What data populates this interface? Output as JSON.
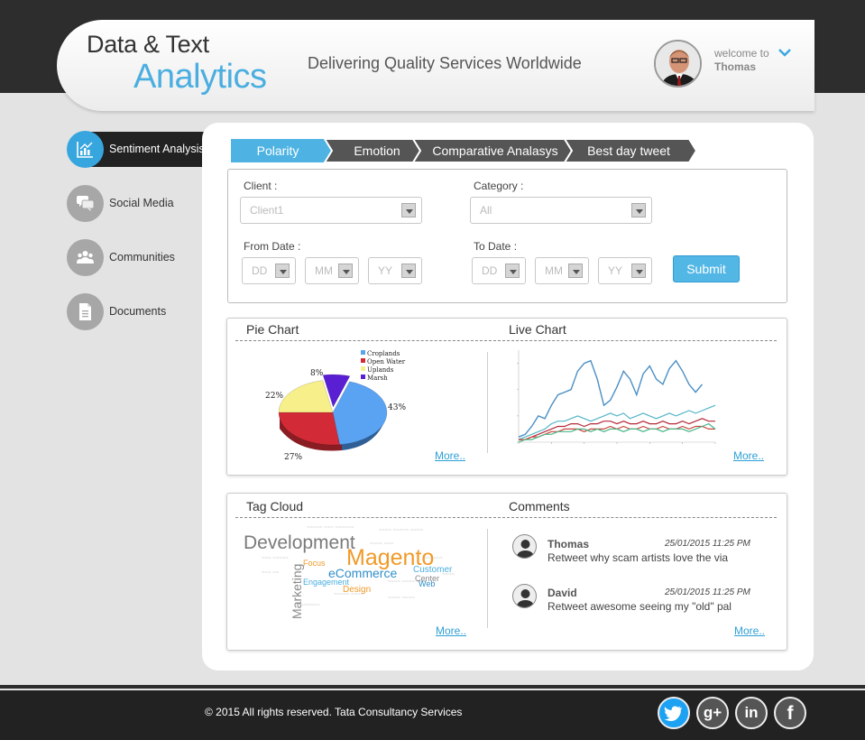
{
  "header": {
    "logo_line1": "Data & Text",
    "logo_line2": "Analytics",
    "tagline": "Delivering Quality Services Worldwide",
    "welcome": "welcome to",
    "user": "Thomas"
  },
  "sidebar": {
    "items": [
      {
        "label": "Sentiment Analysis",
        "icon": "chart-icon",
        "active": true
      },
      {
        "label": "Social Media",
        "icon": "chat-icon",
        "active": false
      },
      {
        "label": "Communities",
        "icon": "people-icon",
        "active": false
      },
      {
        "label": "Documents",
        "icon": "document-icon",
        "active": false
      }
    ]
  },
  "tabs": [
    "Polarity",
    "Emotion",
    "Comparative Analasys",
    "Best day tweet"
  ],
  "form": {
    "client_label": "Client :",
    "client_value": "Client1",
    "category_label": "Category :",
    "category_value": "All",
    "from_label": "From Date :",
    "to_label": "To Date :",
    "dd": "DD",
    "mm": "MM",
    "yy": "YY",
    "submit": "Submit"
  },
  "pie_panel": {
    "title": "Pie Chart",
    "more": "More..",
    "legend": [
      "Croplands",
      "Open Water",
      "Uplands",
      "Marsh"
    ],
    "labels": [
      "43%",
      "27%",
      "22%",
      "8%"
    ],
    "colors": [
      "#5aa2f2",
      "#d22b37",
      "#f7ef8a",
      "#5a1fd3"
    ]
  },
  "live_panel": {
    "title": "Live Chart",
    "more": "More.."
  },
  "chart_data": [
    {
      "type": "pie",
      "title": "",
      "categories": [
        "Croplands",
        "Open Water",
        "Uplands",
        "Marsh"
      ],
      "values": [
        43,
        27,
        22,
        8
      ]
    },
    {
      "type": "line",
      "title": "",
      "xlabel": "",
      "ylabel": "",
      "xlim": [
        0,
        120
      ],
      "ylim": [
        0,
        35
      ],
      "x": [
        0,
        4,
        8,
        12,
        16,
        20,
        24,
        28,
        32,
        36,
        40,
        44,
        48,
        52,
        56,
        60,
        64,
        68,
        72,
        76,
        80,
        84,
        88,
        92,
        96,
        100,
        104,
        108,
        112,
        116,
        120
      ],
      "series": [
        {
          "values": [
            2,
            3,
            6,
            10,
            9,
            14,
            18,
            19,
            20,
            27,
            30,
            31,
            24,
            14,
            16,
            21,
            27,
            24,
            18,
            26,
            29,
            24,
            22,
            28,
            31,
            27,
            22,
            19,
            22,
            null,
            null
          ]
        },
        {
          "values": [
            1,
            2,
            3,
            4,
            5,
            7,
            8,
            8,
            9,
            10,
            9,
            8,
            9,
            10,
            11,
            10,
            11,
            9,
            10,
            11,
            10,
            9,
            10,
            11,
            10,
            11,
            12,
            11,
            12,
            13,
            14
          ]
        },
        {
          "values": [
            1,
            1,
            2,
            3,
            4,
            5,
            6,
            6,
            7,
            7,
            6,
            7,
            7,
            8,
            8,
            7,
            8,
            7,
            7,
            8,
            7,
            7,
            8,
            7,
            7,
            8,
            7,
            8,
            9,
            8,
            8
          ]
        },
        {
          "values": [
            1,
            1,
            2,
            2,
            3,
            4,
            4,
            5,
            5,
            5,
            4,
            5,
            5,
            5,
            6,
            5,
            6,
            5,
            5,
            6,
            5,
            5,
            6,
            5,
            5,
            6,
            5,
            6,
            6,
            5,
            5
          ]
        },
        {
          "values": [
            0,
            1,
            1,
            2,
            3,
            3,
            4,
            4,
            4,
            5,
            5,
            4,
            5,
            4,
            5,
            5,
            4,
            5,
            5,
            4,
            5,
            5,
            4,
            5,
            5,
            5,
            4,
            5,
            6,
            7,
            5
          ]
        }
      ],
      "colors": [
        "#4b8fc4",
        "#54b5c9",
        "#b52a3a",
        "#c9453d",
        "#49b88c"
      ]
    }
  ],
  "tag_panel": {
    "title": "Tag Cloud",
    "more": "More..",
    "words": [
      "Development",
      "Magento",
      "eCommerce",
      "Marketing",
      "Customer",
      "Engagement",
      "Focus",
      "Center",
      "Web",
      "Design"
    ]
  },
  "comments_panel": {
    "title": "Comments",
    "more": "More..",
    "items": [
      {
        "name": "Thomas",
        "time": "25/01/2015 11:25 PM",
        "text": "Retweet why scam artists love the via"
      },
      {
        "name": "David",
        "time": "25/01/2015 11:25 PM",
        "text": "Retweet awesome seeing my \"old\" pal"
      }
    ]
  },
  "footer": {
    "copyright": "© 2015 All rights reserved. Tata Consultancy Services",
    "social": [
      "twitter-icon",
      "google-plus-icon",
      "linkedin-icon",
      "facebook-icon"
    ],
    "social_colors": [
      "#1da1f2",
      "#555555",
      "#555555",
      "#555555"
    ]
  }
}
